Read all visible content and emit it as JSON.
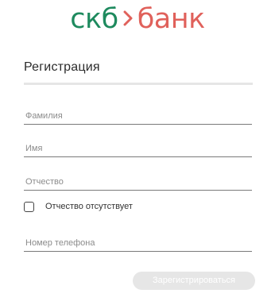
{
  "logo": {
    "left": "скб",
    "right": "банк",
    "chevron_icon": "chevron-right-icon"
  },
  "form": {
    "title": "Регистрация",
    "fields": [
      {
        "name": "last-name",
        "placeholder": "Фамилия",
        "value": ""
      },
      {
        "name": "first-name",
        "placeholder": "Имя",
        "value": ""
      },
      {
        "name": "patronymic",
        "placeholder": "Отчество",
        "value": ""
      },
      {
        "name": "phone",
        "placeholder": "Номер телефона",
        "value": ""
      }
    ],
    "no_patronymic_label": "Отчество отсутствует",
    "no_patronymic_checked": false,
    "submit_label": "Зарегистрироваться"
  },
  "colors": {
    "brand_green": "#1e8a5e",
    "brand_red": "#e0615b",
    "disabled_button": "#e6e6e6"
  }
}
